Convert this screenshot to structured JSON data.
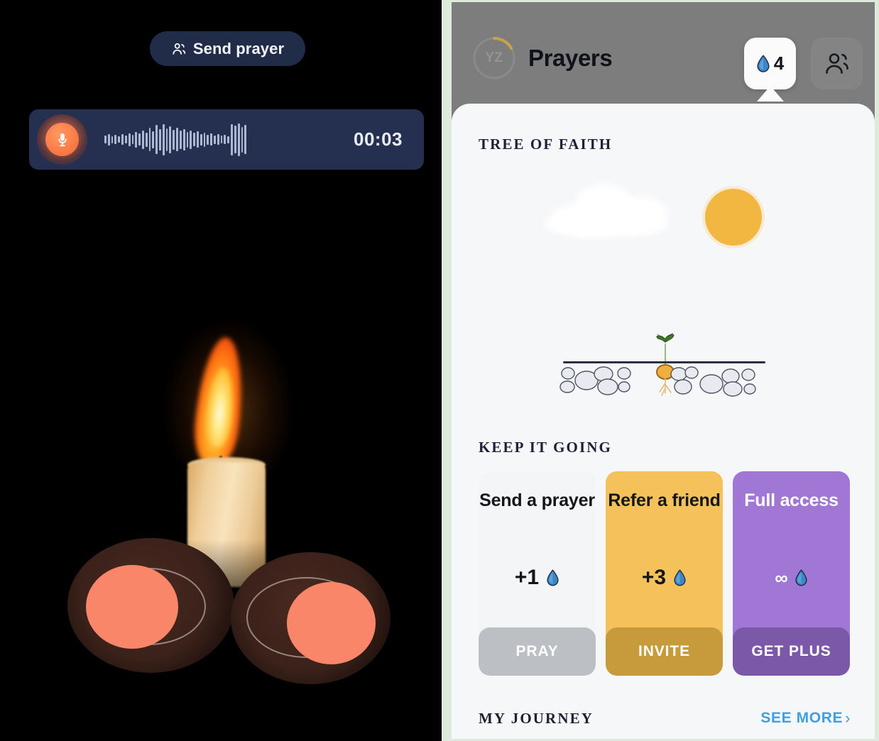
{
  "left": {
    "send_prayer": {
      "label": "Send prayer",
      "icon": "people-icon"
    },
    "recorder": {
      "mic_icon": "microphone-icon",
      "waveform_icon": "audio-waveform",
      "elapsed_time": "00:03"
    },
    "scene": {
      "candle_icon": "lit-candle",
      "disc_left_icon": "prayer-disc",
      "disc_right_icon": "prayer-disc"
    }
  },
  "right": {
    "header": {
      "avatar_initials": "YZ",
      "title": "Prayers",
      "drops_icon": "water-drop-icon",
      "drops_count": "4",
      "friends_icon": "people-icon"
    },
    "tree": {
      "heading": "TREE OF FAITH",
      "sun_icon": "sun-icon",
      "cloud_icon": "cloud-icon",
      "sprout_icon": "sprout-icon",
      "pebbles_icon": "pebbles-icon"
    },
    "keep_it_going": {
      "heading": "KEEP IT GOING",
      "cards": [
        {
          "title": "Send a prayer",
          "reward_amount": "+1",
          "reward_icon": "water-drop-icon",
          "cta": "PRAY",
          "bg_color": "#f4f5f7",
          "cta_color": "#bcbfc4"
        },
        {
          "title": "Refer a friend",
          "reward_amount": "+3",
          "reward_icon": "water-drop-icon",
          "cta": "INVITE",
          "bg_color": "#f5c15b",
          "cta_color": "#c79a3c"
        },
        {
          "title": "Full access",
          "reward_amount": "∞",
          "reward_icon": "water-drop-icon",
          "cta": "GET PLUS",
          "bg_color": "#a077d4",
          "cta_color": "#7b59a8"
        }
      ]
    },
    "journey": {
      "heading": "MY JOURNEY",
      "see_more": "SEE MORE",
      "chevron": "›"
    }
  },
  "colors": {
    "accent_orange": "#fa7f4a",
    "accent_blue": "#3f9fe0",
    "drop_blue": "#3d86c6",
    "navy": "#252f4f",
    "sun_yellow": "#f2b741",
    "purple": "#a077d4"
  }
}
